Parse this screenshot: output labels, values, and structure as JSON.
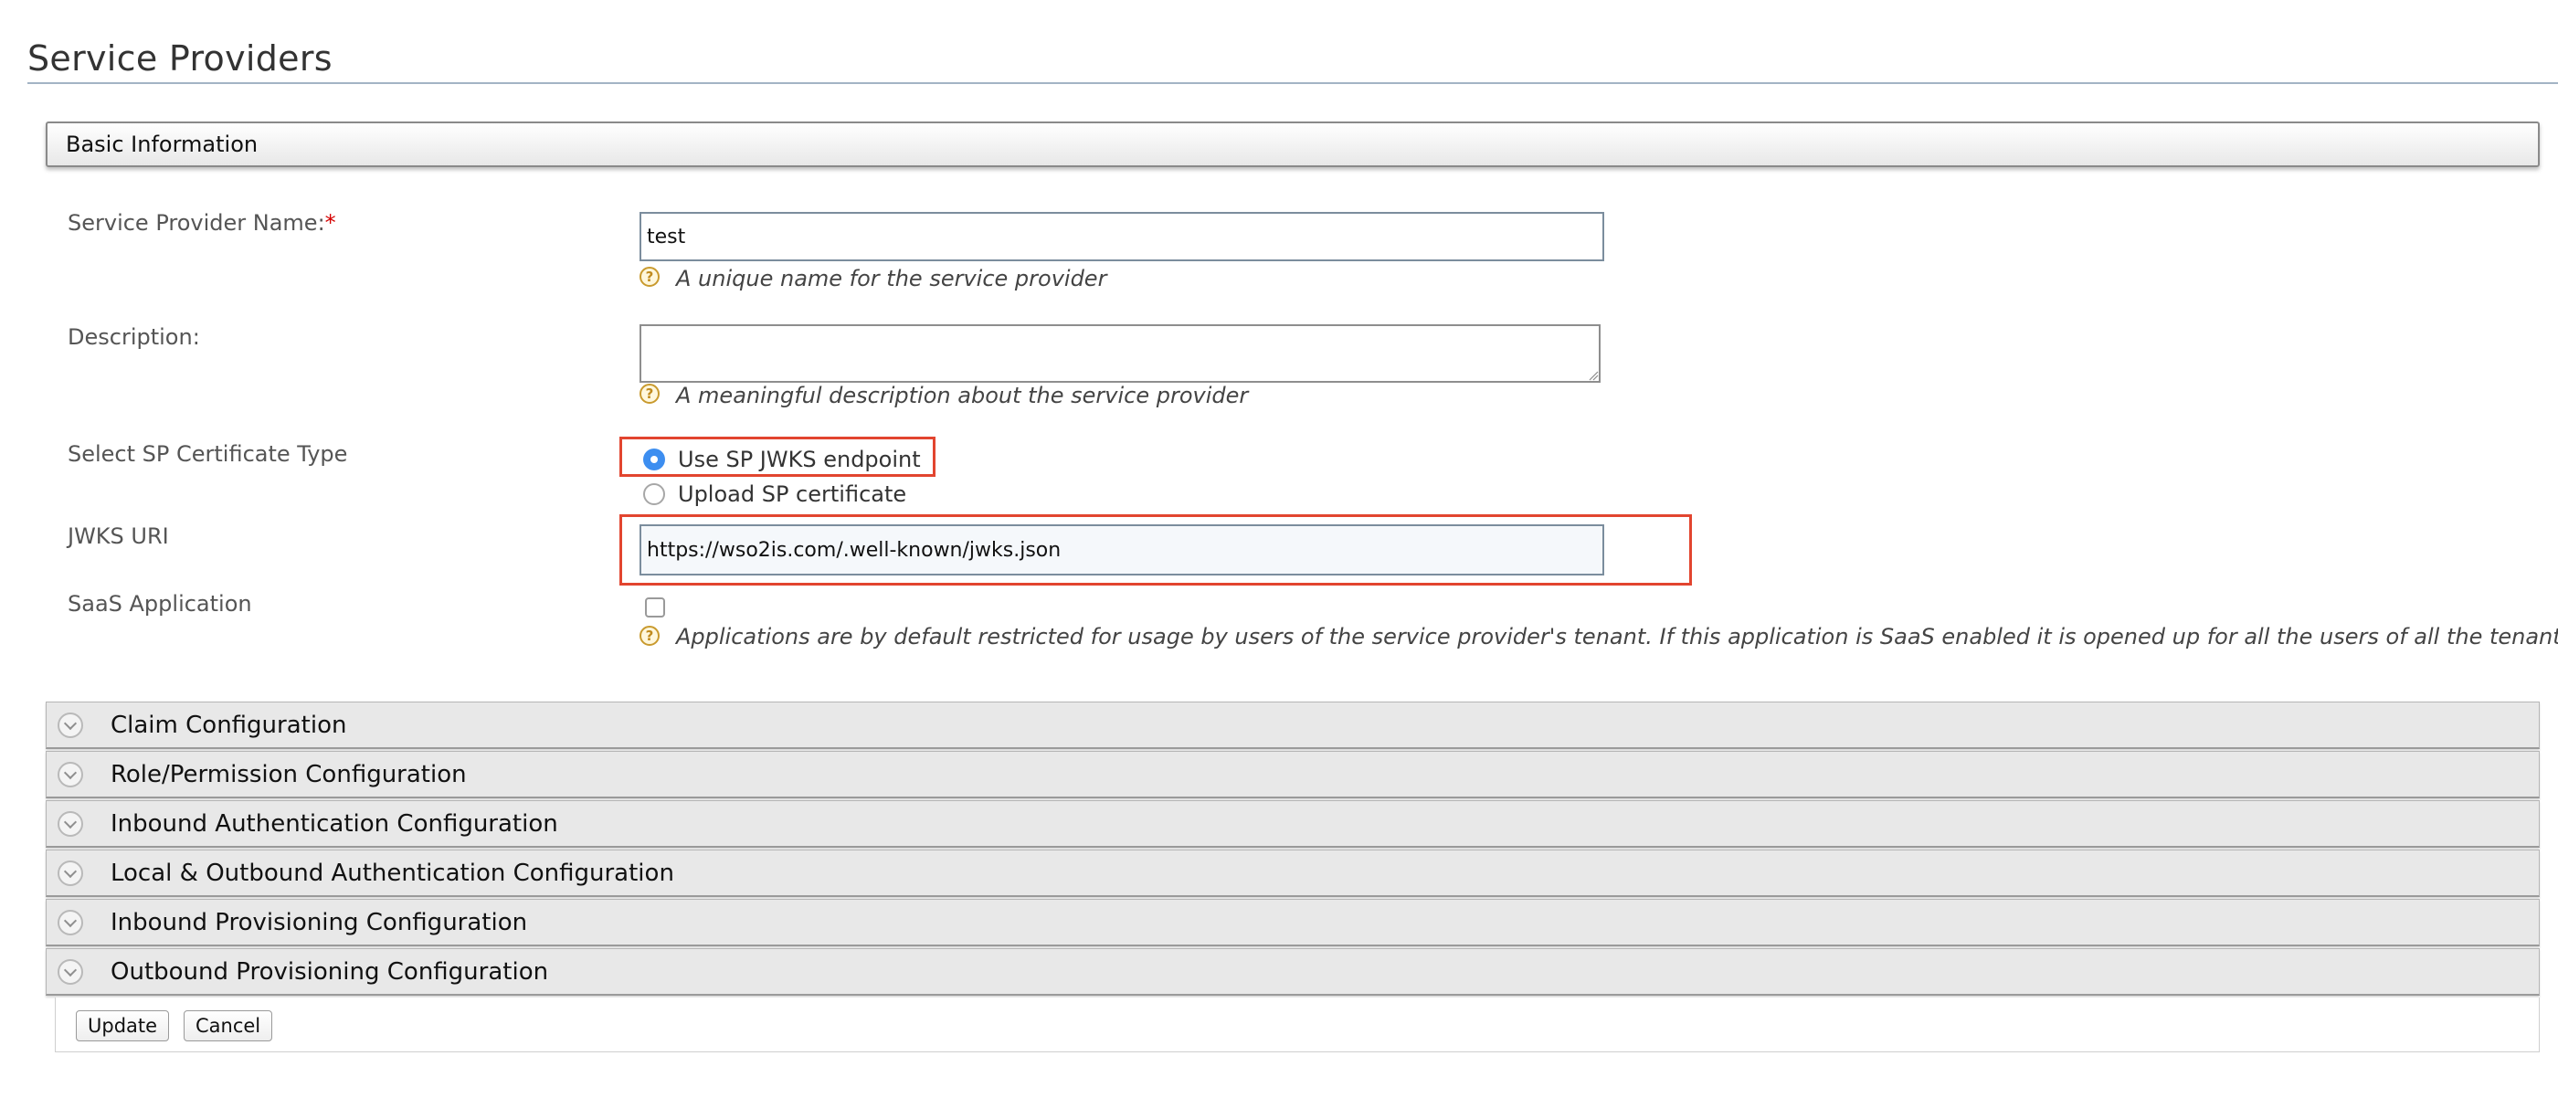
{
  "page": {
    "title": "Service Providers"
  },
  "basic_info": {
    "header": "Basic Information",
    "name": {
      "label": "Service Provider Name:",
      "required_mark": "*",
      "value": "test",
      "hint": "A unique name for the service provider"
    },
    "description": {
      "label": "Description:",
      "value": "",
      "hint": "A meaningful description about the service provider"
    },
    "cert_type": {
      "label": "Select SP Certificate Type",
      "options": [
        {
          "label": "Use SP JWKS endpoint",
          "selected": true
        },
        {
          "label": "Upload SP certificate",
          "selected": false
        }
      ]
    },
    "jwks_uri": {
      "label": "JWKS URI",
      "value": "https://wso2is.com/.well-known/jwks.json"
    },
    "saas": {
      "label": "SaaS Application",
      "checked": false,
      "hint": "Applications are by default restricted for usage by users of the service provider's tenant. If this application is SaaS enabled it is opened up for all the users of all the tenants."
    }
  },
  "panels": [
    {
      "title": "Claim Configuration"
    },
    {
      "title": "Role/Permission Configuration"
    },
    {
      "title": "Inbound Authentication Configuration"
    },
    {
      "title": "Local & Outbound Authentication Configuration"
    },
    {
      "title": "Inbound Provisioning Configuration"
    },
    {
      "title": "Outbound Provisioning Configuration"
    }
  ],
  "actions": {
    "update_label": "Update",
    "cancel_label": "Cancel"
  },
  "colors": {
    "highlight": "#e2452f",
    "radio_selected": "#3d8ef0",
    "required": "#d50000"
  },
  "icons": {
    "help": "help-icon",
    "expand": "chevron-down-icon"
  }
}
